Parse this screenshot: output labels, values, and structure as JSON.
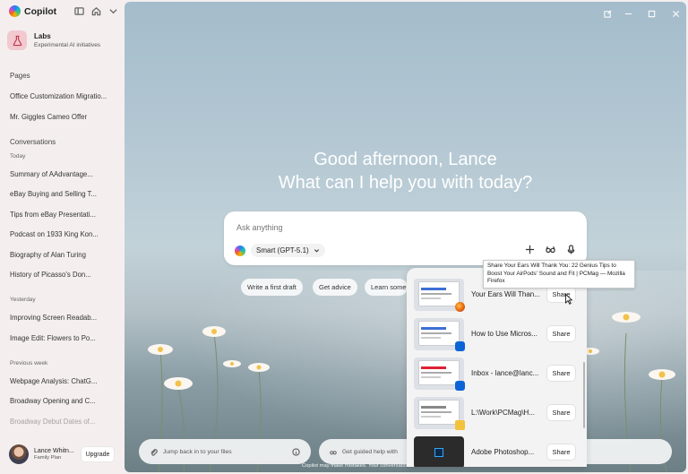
{
  "app": {
    "name": "Copilot"
  },
  "labs": {
    "title": "Labs",
    "subtitle": "Experimental AI initiatives"
  },
  "sidebar": {
    "pages_title": "Pages",
    "pages": [
      "Office Customization Migratio...",
      "Mr. Giggles Cameo Offer"
    ],
    "conversations_title": "Conversations",
    "groups": [
      {
        "label": "Today",
        "items": [
          "Summary of AAdvantage...",
          "eBay Buying and Selling T...",
          "Tips from eBay Presentati...",
          "Podcast on 1933 King Kon...",
          "Biography of Alan Turing",
          "History of Picasso's Don..."
        ]
      },
      {
        "label": "Yesterday",
        "items": [
          "Improving Screen Readab...",
          "Image Edit: Flowers to Po..."
        ]
      },
      {
        "label": "Previous week",
        "items": [
          "Webpage Analysis: ChatG...",
          "Broadway Opening and C...",
          "Broadway Debut Dates of..."
        ]
      }
    ]
  },
  "user": {
    "name": "Lance Whitn...",
    "plan": "Family Plan",
    "upgrade_label": "Upgrade"
  },
  "greeting": {
    "line1": "Good afternoon, Lance",
    "line2": "What can I help you with today?"
  },
  "composer": {
    "placeholder": "Ask anything",
    "model": "Smart (GPT-5.1)"
  },
  "chips": [
    "Write a first draft",
    "Get advice",
    "Learn some"
  ],
  "bottom": {
    "files_label": "Jump back in to your files",
    "guided_label": "Get guided help with yo",
    "disclaimer": "Copilot may make mistakes. Your conversations a"
  },
  "share_panel": {
    "tooltip": "Share Your Ears Will Thank You: 22 Genius Tips to Boost Your AirPods' Sound and Fit | PCMag — Mozilla Firefox",
    "button_label": "Share",
    "rows": [
      {
        "title": "Your Ears Will Than...",
        "app": "firefox",
        "badge_color": "#e66000"
      },
      {
        "title": "How to Use Micros...",
        "app": "outlook",
        "badge_color": "#0a64d6"
      },
      {
        "title": "Inbox - lance@lanc...",
        "app": "outlook",
        "badge_color": "#0a64d6"
      },
      {
        "title": "L:\\Work\\PCMag\\H...",
        "app": "file-explorer",
        "badge_color": "#f3c23c"
      },
      {
        "title": "Adobe Photoshop...",
        "app": "photoshop",
        "badge_color": "#31a8ff"
      }
    ]
  },
  "colors": {
    "labs_bg": "#f1c9cf",
    "sidebar_bg": "#f4efee",
    "sky_top": "#a4bccb"
  }
}
